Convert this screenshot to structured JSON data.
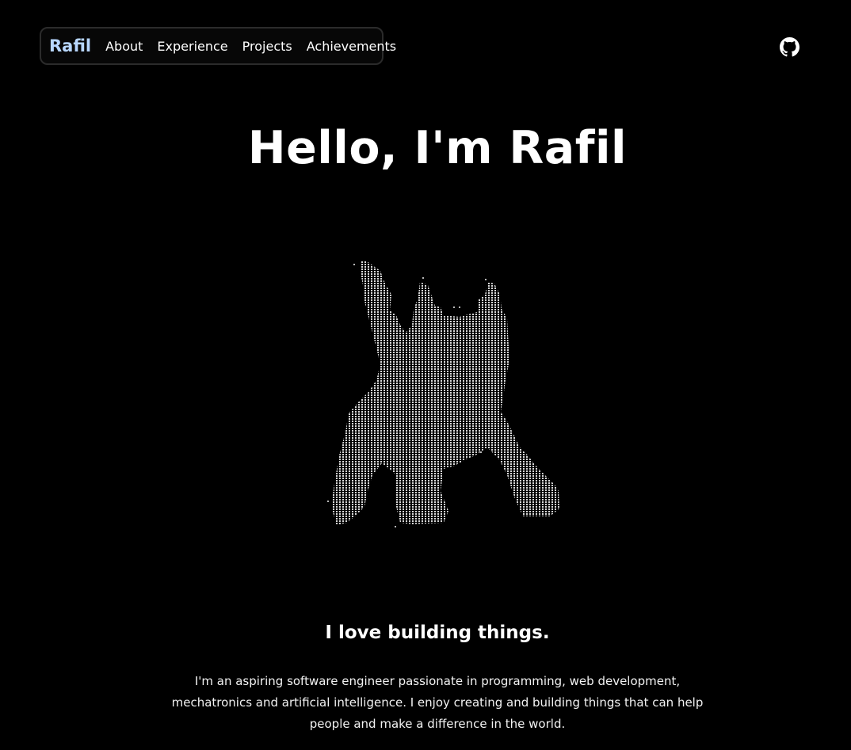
{
  "nav": {
    "brand": "Rafil",
    "links": [
      "About",
      "Experience",
      "Projects",
      "Achievements"
    ]
  },
  "header": {
    "github_icon": "github-icon"
  },
  "hero": {
    "title": "Hello, I'm Rafil",
    "art_icon": "ascii-art-illustration"
  },
  "about": {
    "tagline": "I love building things.",
    "bio": "I'm an aspiring software engineer passionate in programming, web development, mechatronics and artificial intelligence. I enjoy creating and building things that can help people and make a difference in the world."
  },
  "colors": {
    "background": "#000000",
    "brand": "#b7d6ff",
    "nav_border": "#2b2b2b",
    "text": "#ffffff",
    "art": "#d8d8d8"
  }
}
